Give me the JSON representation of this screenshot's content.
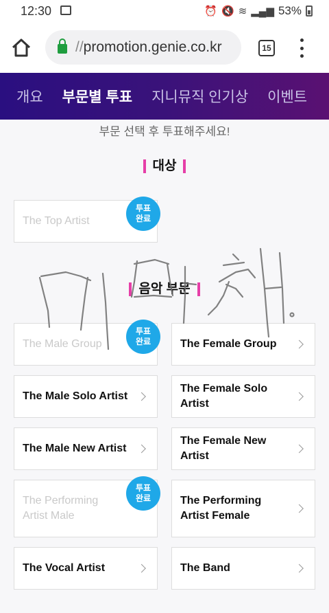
{
  "status_bar": {
    "time": "12:30",
    "battery": "53%"
  },
  "browser": {
    "url_prefix": "//",
    "url_host": "promotion.genie.co.kr",
    "tab_count": "15"
  },
  "nav": {
    "items": [
      "개요",
      "부문별 투표",
      "지니뮤직 인기상",
      "이벤트"
    ],
    "active": 1
  },
  "instruction": "부문 선택 후 투표해주세요!",
  "sections": {
    "grand": {
      "title": "대상"
    },
    "music": {
      "title": "음악 부문"
    }
  },
  "badge_label_line1": "투표",
  "badge_label_line2": "완료",
  "cards": {
    "top_artist": "The Top Artist",
    "male_group": "The Male Group",
    "female_group": "The Female Group",
    "male_solo": "The Male Solo Artist",
    "female_solo": "The Female Solo Artist",
    "male_new": "The Male New Artist",
    "female_new": "The Female New Artist",
    "performing_male_1": "The Performing",
    "performing_male_2": "Artist Male",
    "performing_female_1": "The Performing",
    "performing_female_2": "Artist Female",
    "vocal": "The Vocal Artist",
    "band": "The Band"
  },
  "voted": [
    "top_artist",
    "male_group",
    "performing_male"
  ]
}
